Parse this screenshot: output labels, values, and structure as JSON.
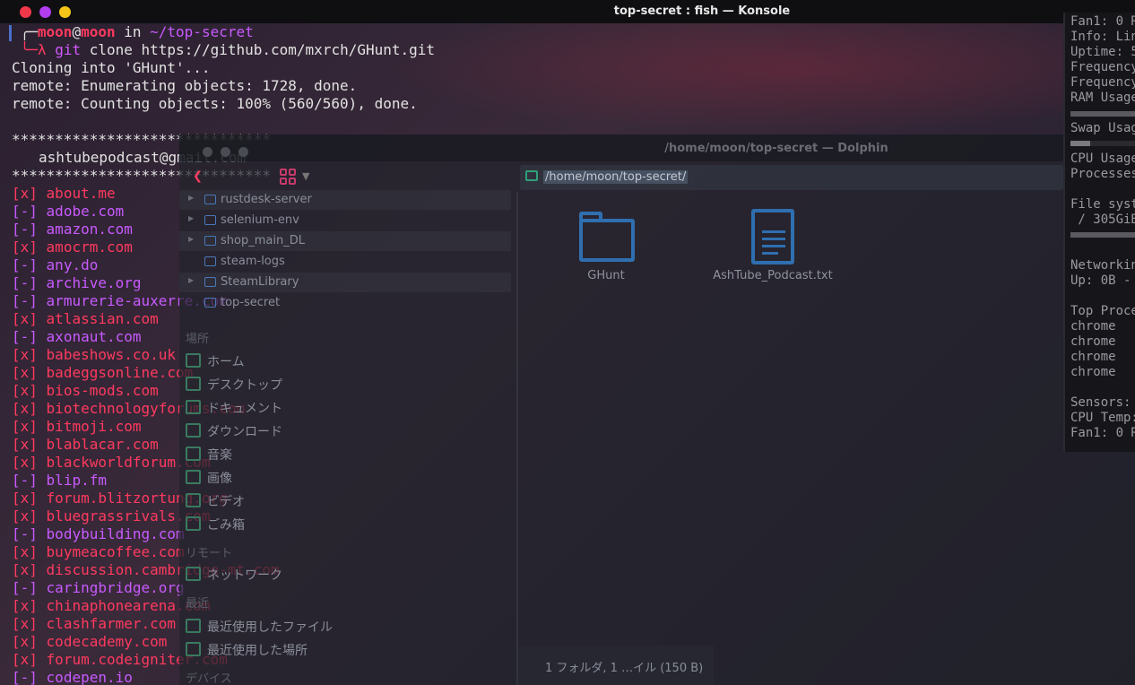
{
  "window": {
    "title": "top-secret : fish — Konsole"
  },
  "terminal": {
    "prompt_user": "moon",
    "prompt_at": "@",
    "prompt_host": "moon",
    "prompt_in": " in ",
    "prompt_path": "~/top-secret",
    "prompt_lambda": "λ",
    "command_git": "git",
    "command_rest": " clone https://github.com/mxrch/GHunt.git",
    "out1": "Cloning into 'GHunt'...",
    "out2": "remote: Enumerating objects: 1728, done.",
    "out3": "remote: Counting objects: 100% (560/560), done.",
    "stars": "******************************",
    "email": "ashtubepodcast@gmail.com"
  },
  "sites": [
    {
      "mark": "[x]",
      "name": "about.me",
      "found": true
    },
    {
      "mark": "[-]",
      "name": "adobe.com",
      "found": false
    },
    {
      "mark": "[-]",
      "name": "amazon.com",
      "found": false
    },
    {
      "mark": "[x]",
      "name": "amocrm.com",
      "found": true
    },
    {
      "mark": "[-]",
      "name": "any.do",
      "found": false
    },
    {
      "mark": "[-]",
      "name": "archive.org",
      "found": false
    },
    {
      "mark": "[-]",
      "name": "armurerie-auxerre.com",
      "found": false
    },
    {
      "mark": "[x]",
      "name": "atlassian.com",
      "found": true
    },
    {
      "mark": "[-]",
      "name": "axonaut.com",
      "found": false
    },
    {
      "mark": "[x]",
      "name": "babeshows.co.uk",
      "found": true
    },
    {
      "mark": "[x]",
      "name": "badeggsonline.com",
      "found": true
    },
    {
      "mark": "[x]",
      "name": "bios-mods.com",
      "found": true
    },
    {
      "mark": "[x]",
      "name": "biotechnologyforums.com",
      "found": true
    },
    {
      "mark": "[x]",
      "name": "bitmoji.com",
      "found": true
    },
    {
      "mark": "[x]",
      "name": "blablacar.com",
      "found": true
    },
    {
      "mark": "[x]",
      "name": "blackworldforum.com",
      "found": true
    },
    {
      "mark": "[-]",
      "name": "blip.fm",
      "found": false
    },
    {
      "mark": "[x]",
      "name": "forum.blitzortung.org",
      "found": true
    },
    {
      "mark": "[x]",
      "name": "bluegrassrivals.com",
      "found": true
    },
    {
      "mark": "[-]",
      "name": "bodybuilding.com",
      "found": false
    },
    {
      "mark": "[x]",
      "name": "buymeacoffee.com",
      "found": true
    },
    {
      "mark": "[x]",
      "name": "discussion.cambridge-mt.com",
      "found": true
    },
    {
      "mark": "[-]",
      "name": "caringbridge.org",
      "found": false
    },
    {
      "mark": "[x]",
      "name": "chinaphonearena.com",
      "found": true
    },
    {
      "mark": "[x]",
      "name": "clashfarmer.com",
      "found": true
    },
    {
      "mark": "[x]",
      "name": "codecademy.com",
      "found": true
    },
    {
      "mark": "[x]",
      "name": "forum.codeigniter.com",
      "found": true
    },
    {
      "mark": "[-]",
      "name": "codepen.io",
      "found": false
    }
  ],
  "dolphin": {
    "title": "/home/moon/top-secret — Dolphin",
    "address": "/home/moon/top-secret/",
    "tree": [
      {
        "label": "rustdesk-server",
        "expandable": true
      },
      {
        "label": "selenium-env",
        "expandable": true
      },
      {
        "label": "shop_main_DL",
        "expandable": true
      },
      {
        "label": "steam-logs",
        "expandable": false
      },
      {
        "label": "SteamLibrary",
        "expandable": true
      },
      {
        "label": "top-secret",
        "expandable": false
      }
    ],
    "places_header": "場所",
    "places": [
      "ホーム",
      "デスクトップ",
      "ドキュメント",
      "ダウンロード",
      "音楽",
      "画像",
      "ビデオ",
      "ごみ箱"
    ],
    "remote_header": "リモート",
    "remote": [
      "ネットワーク"
    ],
    "recent_header": "最近",
    "recent": [
      "最近使用したファイル",
      "最近使用した場所"
    ],
    "devices_header": "デバイス",
    "files": [
      {
        "name": "GHunt",
        "icon": "folder-icon"
      },
      {
        "name": "AshTube_Podcast.txt",
        "icon": "text-file-icon"
      }
    ],
    "status": "1 フォルダ, 1 …イル (150 B)"
  },
  "sysmon": {
    "lines_top": [
      "Fan1: 0 R",
      "Info: Lin",
      "Uptime: 5",
      "Frequency",
      "Frequency",
      "RAM Usage"
    ],
    "swap": "Swap Usag",
    "cpu": "CPU Usage",
    "processes": "Processes",
    "fs": "File syst",
    "fs_root": " / 305GiB",
    "networking": "Networkin",
    "up": "Up: 0B -",
    "top_proc": "Top Proce",
    "procs": [
      "chrome",
      "chrome",
      "chrome",
      "chrome"
    ],
    "sensors": "Sensors:",
    "cpu_temp": "CPU Temp:",
    "fan": "Fan1: 0 R"
  }
}
